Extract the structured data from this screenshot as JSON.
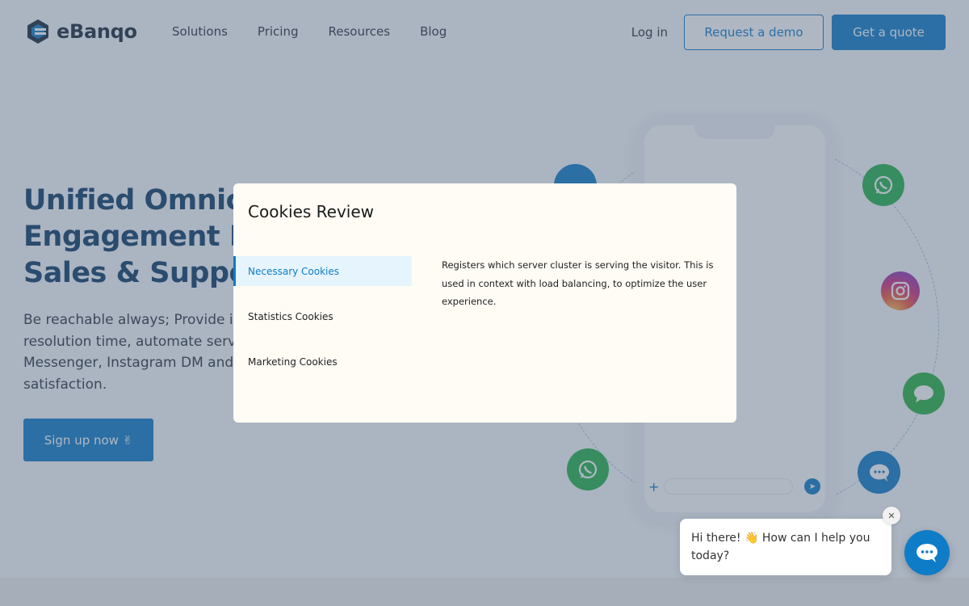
{
  "brand": {
    "name": "eBanqo",
    "color": "#0f7cc7",
    "dark": "#0e3d66"
  },
  "nav": {
    "links": [
      "Solutions",
      "Pricing",
      "Resources",
      "Blog"
    ],
    "login": "Log in",
    "demo_button": "Request a demo",
    "quote_button": "Get a quote"
  },
  "hero": {
    "title_lines": [
      "Unified Omnichannel",
      "Engagement Platform for",
      "Sales & Support"
    ],
    "description": "Be reachable always; Provide instant responses, speed up resolution time, automate service on WhatsApp, Facebook Messenger, Instagram DM and more to improve customer satisfaction.",
    "cta": "Sign up now ✌"
  },
  "icons": {
    "social": [
      "whatsapp-icon",
      "instagram-icon",
      "chat-bubble-icon",
      "messenger-chat-icon",
      "whatsapp-icon",
      "chat-icon"
    ]
  },
  "cookie_modal": {
    "title": "Cookies Review",
    "tabs": [
      {
        "label": "Necessary Cookies",
        "active": true
      },
      {
        "label": "Statistics Cookies",
        "active": false
      },
      {
        "label": "Marketing Cookies",
        "active": false
      }
    ],
    "description": "Registers which server cluster is serving the visitor. This is used in context with load balancing, to optimize the user experience."
  },
  "chat_widget": {
    "greeting": "Hi there! 👋 How can I help you today?",
    "close_symbol": "✕"
  }
}
